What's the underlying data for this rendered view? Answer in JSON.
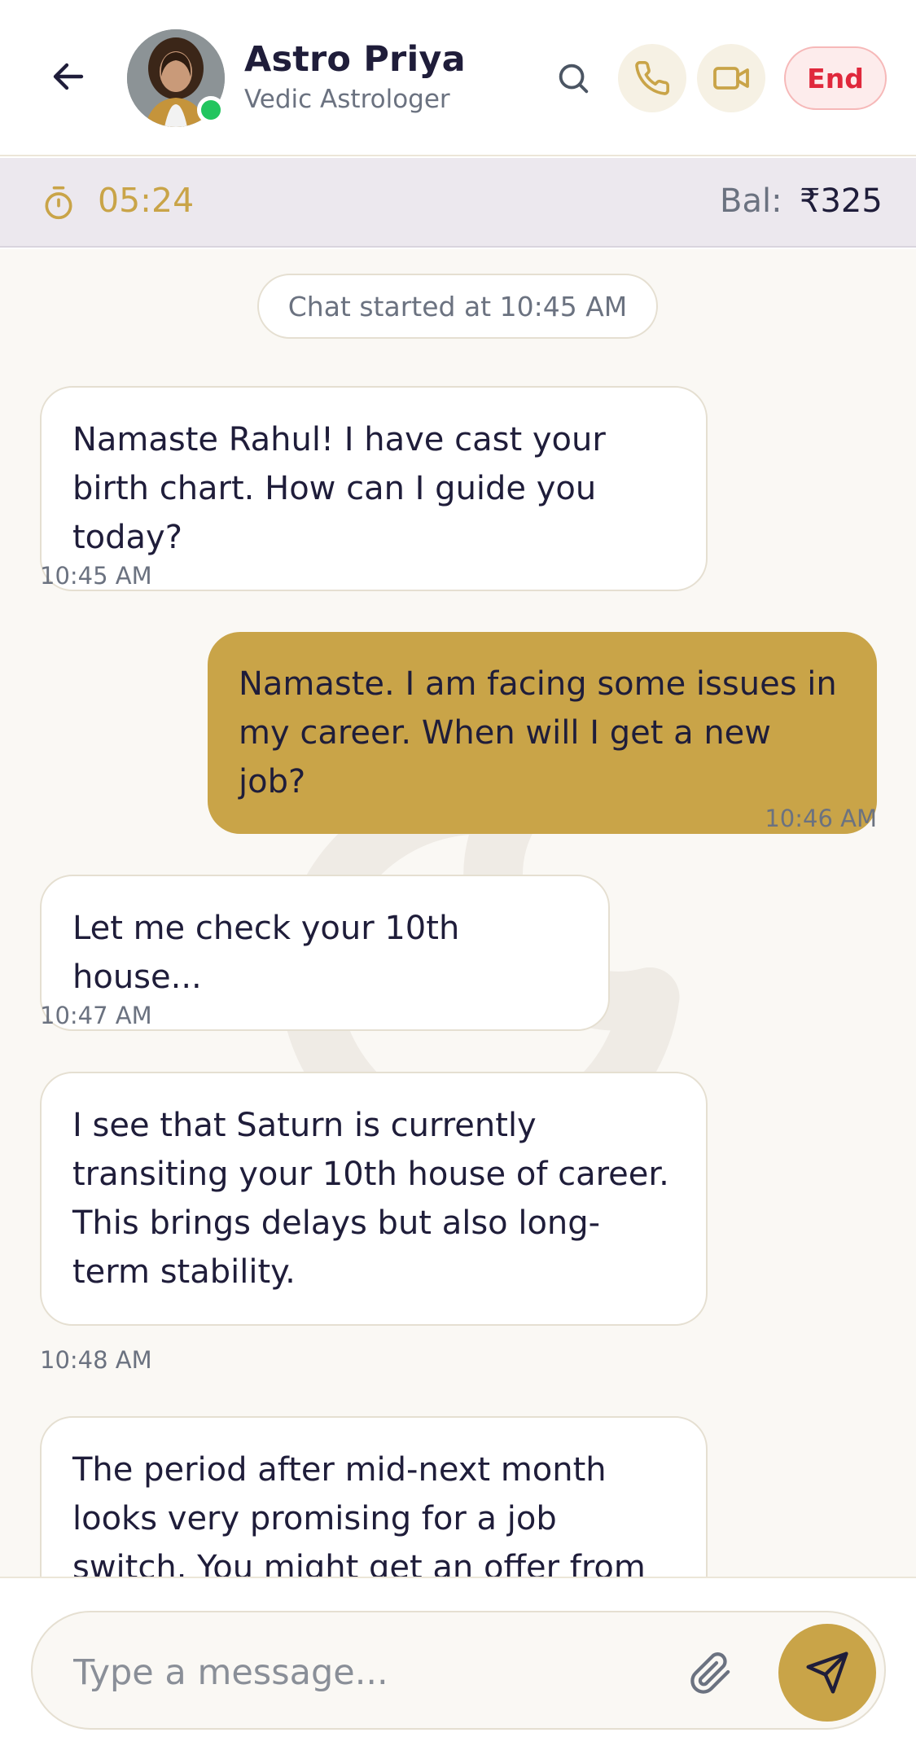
{
  "header": {
    "back_icon": "arrow-left-icon",
    "name": "Astro Priya",
    "role": "Vedic Astrologer",
    "online": true,
    "search_icon": "search-icon",
    "call_icon": "phone-icon",
    "video_icon": "video-icon",
    "end_label": "End"
  },
  "session": {
    "timer": "05:24",
    "balance_label": "Bal:",
    "balance_value": "₹325"
  },
  "chat": {
    "started_label": "Chat started at 10:45 AM",
    "messages": [
      {
        "side": "in",
        "text": "Namaste Rahul! I have cast your birth chart. How can I guide you today?",
        "time": "10:45 AM"
      },
      {
        "side": "out",
        "text": "Namaste. I am facing some issues in my career. When will I get a new job?",
        "time": "10:46 AM"
      },
      {
        "side": "in",
        "text": "Let me check your 10th house...",
        "time": "10:47 AM"
      },
      {
        "side": "in",
        "text": "I see that Saturn is currently transiting your 10th house of career. This brings delays but also long-term stability.",
        "time": "10:48 AM"
      },
      {
        "side": "in",
        "text": "The period after mid-next month looks very promising for a job switch. You might get an offer from a",
        "time": ""
      }
    ]
  },
  "composer": {
    "placeholder": "Type a message...",
    "attach_icon": "paperclip-icon",
    "send_icon": "send-icon"
  },
  "colors": {
    "accent": "#c9a448",
    "end_red": "#e0283c",
    "online_green": "#22c55e",
    "chat_bg": "#faf8f4",
    "timer_bar_bg": "#ece8ee"
  }
}
